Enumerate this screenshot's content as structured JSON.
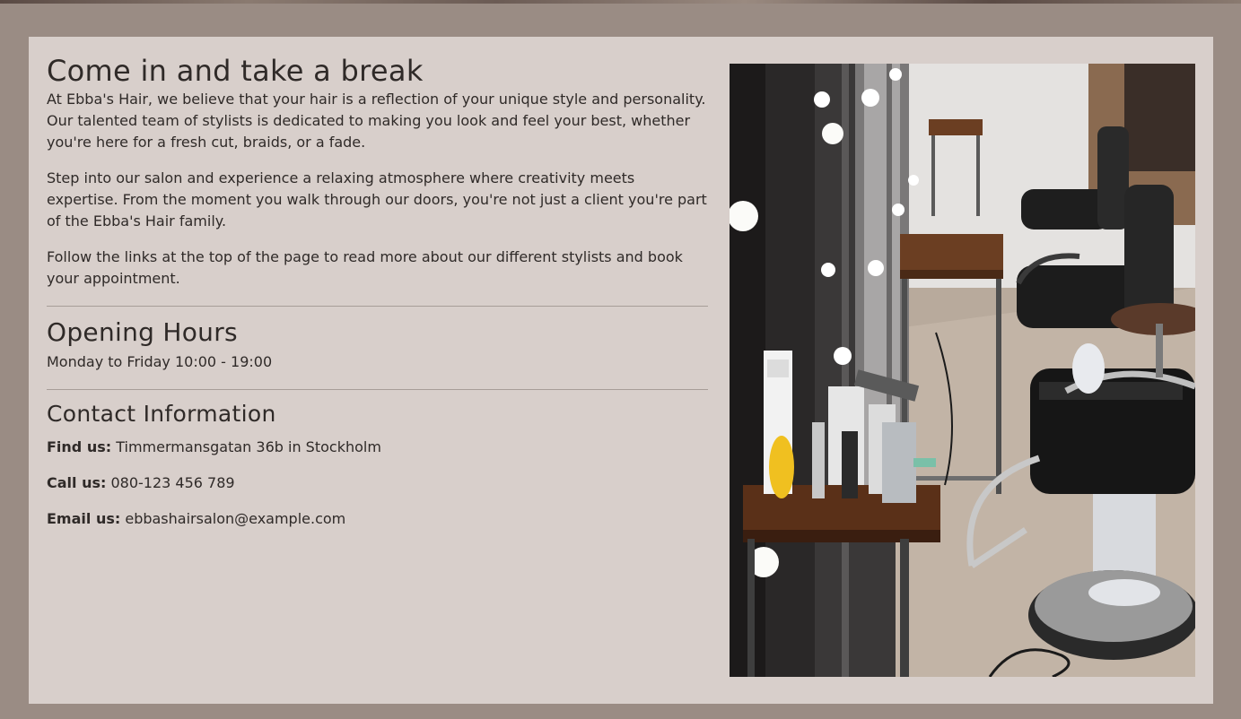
{
  "intro": {
    "heading": "Come in and take a break",
    "paragraph1": "At Ebba's Hair, we believe that your hair is a reflection of your unique style and personality. Our talented team of stylists is dedicated to making you look and feel your best, whether you're here for a fresh cut, braids, or a fade.",
    "paragraph2": "Step into our salon and experience a relaxing atmosphere where creativity meets expertise. From the moment you walk through our doors, you're not just a client you're part of the Ebba's Hair family.",
    "paragraph3": "Follow the links at the top of the page to read more about our different stylists and book your appointment."
  },
  "opening_hours": {
    "heading": "Opening Hours",
    "text": "Monday to Friday 10:00 - 19:00"
  },
  "contact": {
    "heading": "Contact Information",
    "find_label": "Find us:",
    "find_value": "Timmermansgatan 36b in Stockholm",
    "call_label": "Call us:",
    "call_value": "080-123 456 789",
    "email_label": "Email us:",
    "email_value": "ebbashairsalon@example.com"
  },
  "colors": {
    "page_background": "#9a8c84",
    "card_background": "#d8cfcb",
    "text": "#2f2a28"
  }
}
